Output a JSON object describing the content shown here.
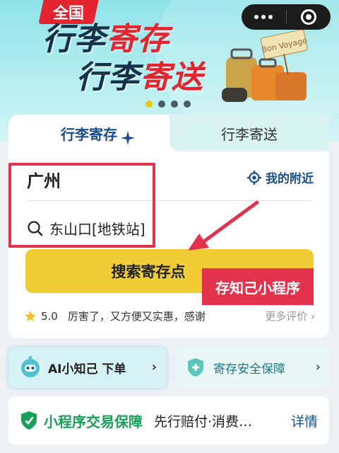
{
  "banner": {
    "badge": "全国",
    "line1_dark": "行李",
    "line1_red": "寄存",
    "line2_dark": "行李",
    "line2_red": "寄送",
    "luggage_tag": "Bon Voyage",
    "carousel": {
      "total": 4,
      "active": 0
    }
  },
  "tabs": [
    {
      "label": "行李寄存",
      "active": true
    },
    {
      "label": "行李寄送",
      "active": false
    }
  ],
  "search": {
    "city": "广州",
    "nearby_label": "我的附近",
    "station": "东山口[地铁站]",
    "button_label": "搜索寄存点"
  },
  "review": {
    "score": "5.0",
    "text": "厉害了，又方便又实惠，感谢",
    "more_label": "更多评价"
  },
  "overlay": {
    "label": "存知己小程序"
  },
  "ai_card": {
    "label": "AI小知己 下单"
  },
  "safe_card": {
    "label": "寄存安全保障"
  },
  "trade_card": {
    "title": "小程序交易保障",
    "desc": "先行赔付·消费…",
    "detail": "详情"
  },
  "colors": {
    "accent_blue": "#1a4e8c",
    "button_yellow": "#f0cd35",
    "highlight_red": "#e3324c",
    "tab_inactive_bg": "#d9f3f3",
    "safe_green": "#18a058"
  }
}
